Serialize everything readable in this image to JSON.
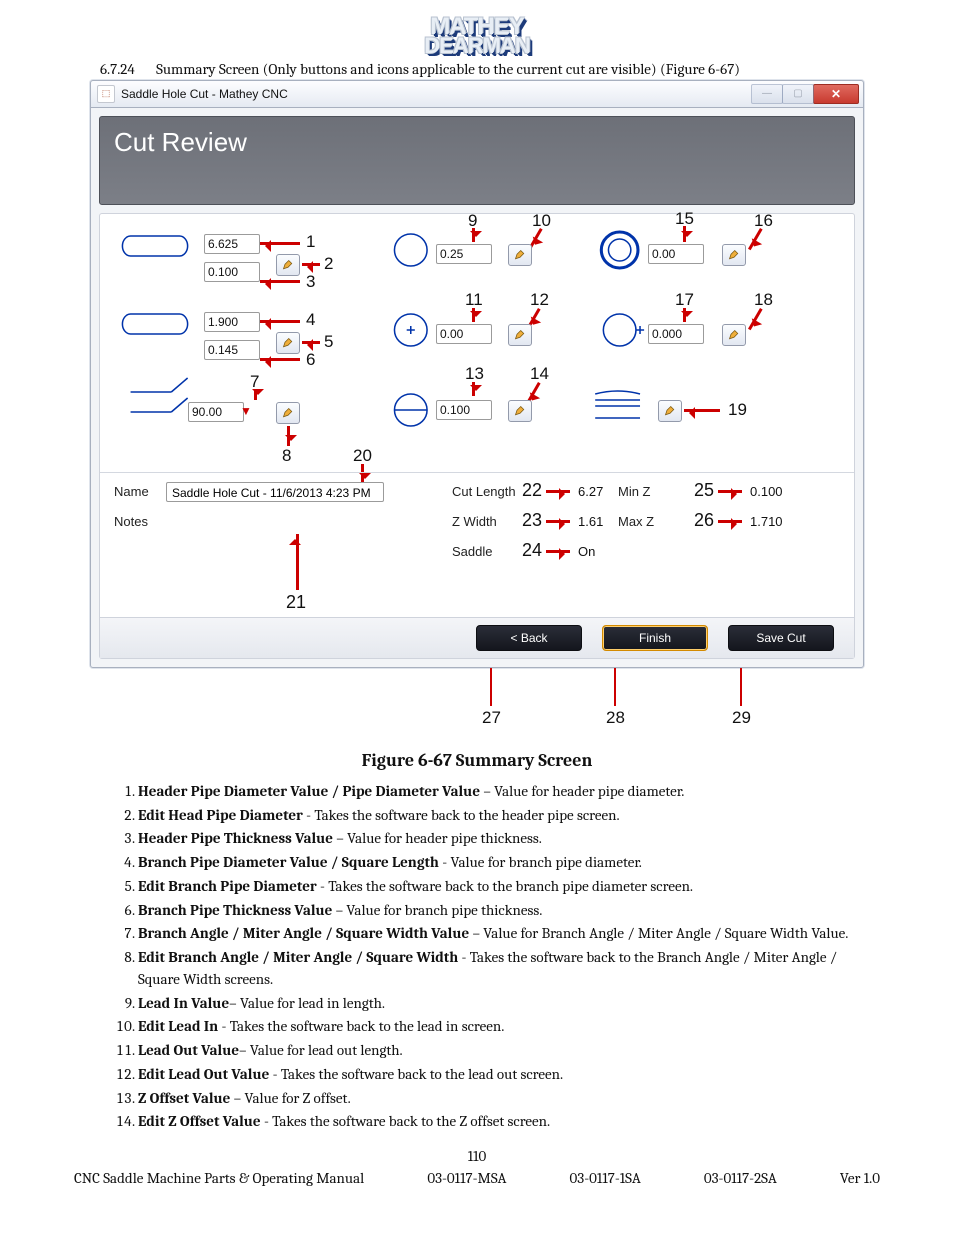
{
  "logo": {
    "line1": "MATHEY",
    "line2": "DEARMAN"
  },
  "section": {
    "number": "6.7.24",
    "title": "Summary Screen (Only buttons and icons applicable to the current cut are visible) (Figure 6-67)"
  },
  "window": {
    "title": "Saddle Hole Cut - Mathey CNC",
    "banner": "Cut Review",
    "buttons": {
      "back": "< Back",
      "finish": "Finish",
      "save": "Save Cut"
    }
  },
  "values": {
    "v1": "6.625",
    "v3": "0.100",
    "v4": "1.900",
    "v6": "0.145",
    "v7": "90.00",
    "v9": "0.25",
    "v11": "0.00",
    "v13": "0.100",
    "v15": "0.00",
    "v17": "0.000"
  },
  "meta": {
    "name_label": "Name",
    "name_value": "Saddle Hole Cut - 11/6/2013 4:23 PM",
    "notes_label": "Notes",
    "cutlen_label": "Cut Length",
    "cutlen_value": "6.27",
    "zwidth_label": "Z Width",
    "zwidth_value": "1.61",
    "saddle_label": "Saddle",
    "saddle_value": "On",
    "minz_label": "Min Z",
    "minz_value": "0.100",
    "maxz_label": "Max Z",
    "maxz_value": "1.710"
  },
  "callouts": {
    "c1": "1",
    "c2": "2",
    "c3": "3",
    "c4": "4",
    "c5": "5",
    "c6": "6",
    "c7": "7",
    "c8": "8",
    "c9": "9",
    "c10": "10",
    "c11": "11",
    "c12": "12",
    "c13": "13",
    "c14": "14",
    "c15": "15",
    "c16": "16",
    "c17": "17",
    "c18": "18",
    "c19": "19",
    "c20": "20",
    "c21": "21",
    "c22": "22",
    "c23": "23",
    "c24": "24",
    "c25": "25",
    "c26": "26",
    "c27": "27",
    "c28": "28",
    "c29": "29"
  },
  "figure_caption": "Figure 6-67 Summary Screen",
  "legend": [
    {
      "b": "Header Pipe Diameter Value / Pipe Diameter Value",
      "t": " – Value for header pipe diameter."
    },
    {
      "b": "Edit Head Pipe Diameter",
      "t": " - Takes the software back to the header pipe screen."
    },
    {
      "b": "Header Pipe Thickness Value",
      "t": " – Value for header pipe thickness."
    },
    {
      "b": "Branch Pipe Diameter Value / Square Length",
      "t": " - Value for branch pipe diameter."
    },
    {
      "b": "Edit Branch Pipe Diameter",
      "t": " - Takes the software back to the branch pipe diameter screen."
    },
    {
      "b": "Branch Pipe Thickness Value",
      "t": " – Value for branch pipe thickness."
    },
    {
      "b": "Branch Angle / Miter Angle / Square Width Value",
      "t": " – Value for Branch Angle / Miter Angle / Square Width Value."
    },
    {
      "b": "Edit Branch Angle / Miter Angle / Square Width",
      "t": " - Takes the software back to the Branch Angle / Miter Angle / Square Width screens."
    },
    {
      "b": "Lead In Value",
      "t": "– Value for lead in length."
    },
    {
      "b": "Edit Lead In",
      "t": " - Takes the software back to the lead in screen."
    },
    {
      "b": "Lead Out Value",
      "t": "– Value for lead out length."
    },
    {
      "b": "Edit Lead Out Value",
      "t": " - Takes the software back to the lead out screen."
    },
    {
      "b": "Z Offset Value",
      "t": " – Value for Z offset."
    },
    {
      "b": "Edit Z Offset Value",
      "t": " - Takes the software back to the Z offset screen."
    }
  ],
  "page_number": "110",
  "footer": {
    "left": "CNC Saddle Machine Parts & Operating Manual",
    "mid1": "03-0117-MSA",
    "mid2": "03-0117-1SA",
    "mid3": "03-0117-2SA",
    "right": "Ver 1.0"
  }
}
